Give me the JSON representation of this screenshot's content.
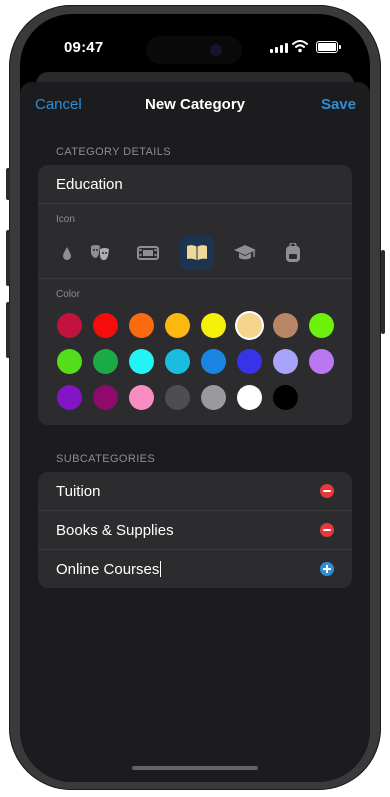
{
  "status_bar": {
    "time": "09:47"
  },
  "nav": {
    "cancel": "Cancel",
    "title": "New Category",
    "save": "Save"
  },
  "details": {
    "header": "CATEGORY DETAILS",
    "name_value": "Education",
    "icon_label": "Icon",
    "icons": [
      "drop-icon",
      "theater-masks-icon",
      "film-frame-icon",
      "book-open-icon",
      "graduation-cap-icon",
      "backpack-icon"
    ],
    "selected_icon": "book-open-icon",
    "color_label": "Color",
    "colors": [
      "#c2123f",
      "#f50d0d",
      "#fa6a0f",
      "#fbb80f",
      "#f5f00b",
      "#f5d58b",
      "#b98567",
      "#6df20e",
      "#52de1a",
      "#1aab45",
      "#22f4f6",
      "#1abddf",
      "#1b85e2",
      "#3634e6",
      "#a8a4fa",
      "#b978f2",
      "#8216c5",
      "#8e0a6b",
      "#f88dc1",
      "#4e4e50",
      "#9a9a9c",
      "#ffffff",
      "#000000"
    ],
    "selected_color": "#f5d58b"
  },
  "subcategories": {
    "header": "SUBCATEGORIES",
    "items": [
      "Tuition",
      "Books & Supplies"
    ],
    "new_item_value": "Online Courses"
  }
}
